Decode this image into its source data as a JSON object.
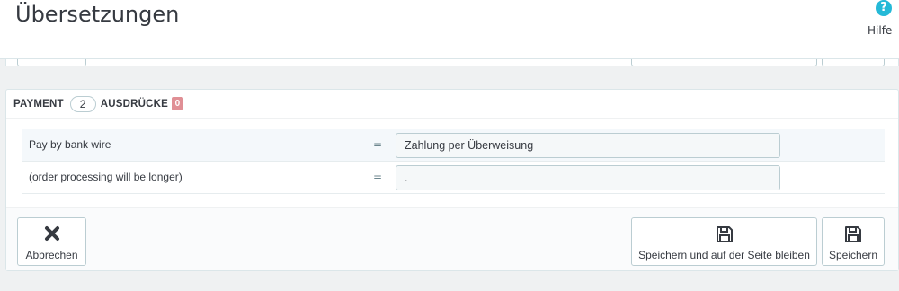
{
  "header": {
    "title": "Übersetzungen",
    "help_label": "Hilfe",
    "help_icon": "?"
  },
  "panel": {
    "heading": "PAYMENT",
    "count": "2",
    "expressions_label": "AUSDRÜCKE",
    "missing_count": "0",
    "rows": [
      {
        "source": "Pay by bank wire",
        "equals": "=",
        "value": "Zahlung per Überweisung"
      },
      {
        "source": "(order processing will be longer)",
        "equals": "=",
        "value": "."
      }
    ]
  },
  "footer": {
    "cancel_label": "Abbrechen",
    "save_stay_label": "Speichern und auf der Seite bleiben",
    "save_label": "Speichern"
  },
  "colors": {
    "accent": "#25b9d7",
    "missing_badge": "#e08f95",
    "background": "#eff1f2"
  }
}
